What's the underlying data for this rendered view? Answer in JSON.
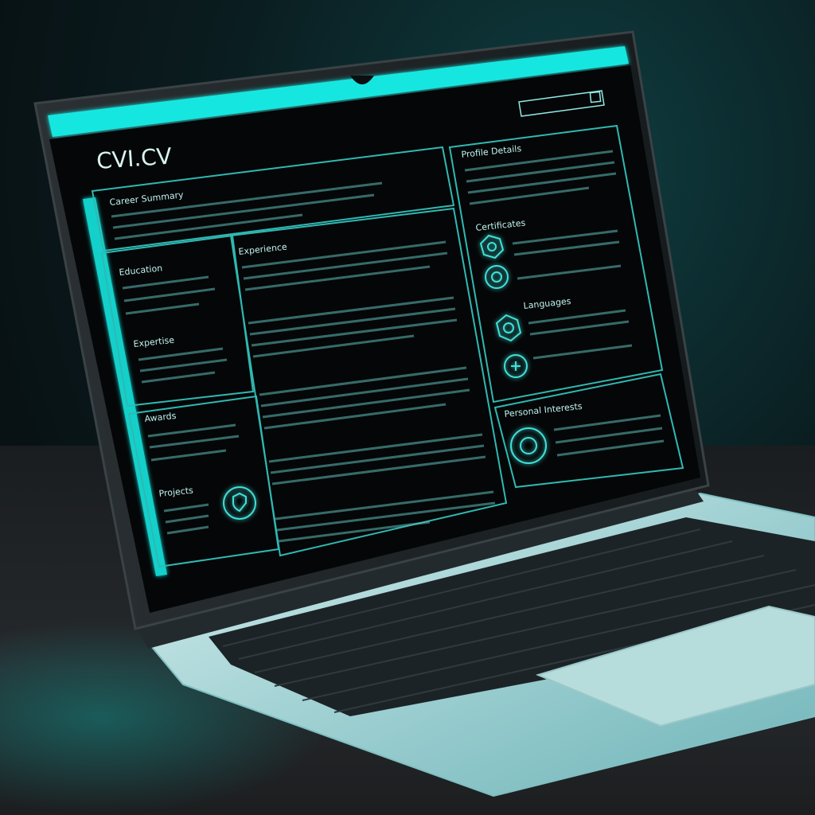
{
  "screen": {
    "logo": "CVI.CV",
    "accent": "#19e6e0",
    "frame": "#0b0f10",
    "panel_bg": "#050607"
  },
  "panels": {
    "summary_heading": "Career Summary",
    "experience_heading": "Experience",
    "left_top_heading": "Education",
    "left_mid_heading": "Expertise",
    "left_low_heading": "Awards",
    "left_bottom_heading": "Projects",
    "right_top_heading": "Profile Details",
    "right_mid_heading": "Certificates",
    "right_low_heading": "Languages",
    "right_bottom_heading": "Personal Interests"
  },
  "icons": {
    "badge_icon": "shield-badge-icon",
    "cert_icon": "hex-badge-icon"
  },
  "colors": {
    "laptop_body": "#a9d3d4",
    "keyboard": "#1c2326",
    "trackpad": "#b6dcdc"
  }
}
